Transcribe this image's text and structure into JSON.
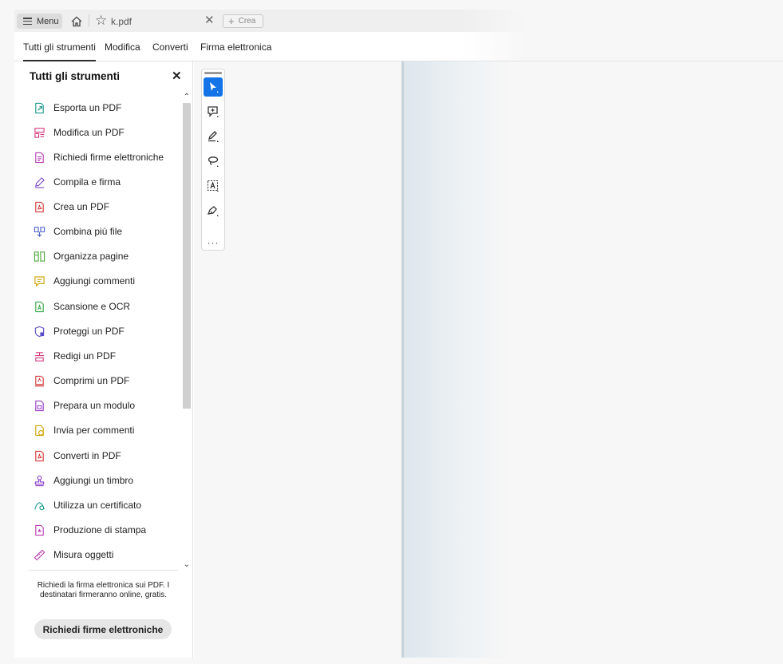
{
  "titlebar": {
    "menu_label": "Menu",
    "tab_title": "k.pdf",
    "new_tab_label": "Crea"
  },
  "topnav": {
    "items": [
      "Tutti gli strumenti",
      "Modifica",
      "Converti",
      "Firma elettronica"
    ]
  },
  "panel": {
    "title": "Tutti gli strumenti",
    "tools": [
      {
        "label": "Esporta un PDF",
        "icon": "export-pdf-icon",
        "color": "#1a9a8a"
      },
      {
        "label": "Modifica un PDF",
        "icon": "edit-pdf-icon",
        "color": "#d63b80"
      },
      {
        "label": "Richiedi firme elettroniche",
        "icon": "request-signatures-icon",
        "color": "#b83fb0"
      },
      {
        "label": "Compila e firma",
        "icon": "fill-sign-icon",
        "color": "#7d4cc7"
      },
      {
        "label": "Crea un PDF",
        "icon": "create-pdf-icon",
        "color": "#d63a3a"
      },
      {
        "label": "Combina più file",
        "icon": "combine-files-icon",
        "color": "#4f63c9"
      },
      {
        "label": "Organizza pagine",
        "icon": "organize-pages-icon",
        "color": "#4da83a"
      },
      {
        "label": "Aggiungi commenti",
        "icon": "add-comments-icon",
        "color": "#d2a200"
      },
      {
        "label": "Scansione e OCR",
        "icon": "scan-ocr-icon",
        "color": "#3aa84a"
      },
      {
        "label": "Proteggi un PDF",
        "icon": "protect-pdf-icon",
        "color": "#5b4fc9"
      },
      {
        "label": "Redigi un PDF",
        "icon": "redact-pdf-icon",
        "color": "#d63b80"
      },
      {
        "label": "Comprimi un PDF",
        "icon": "compress-pdf-icon",
        "color": "#d63a3a"
      },
      {
        "label": "Prepara un modulo",
        "icon": "prepare-form-icon",
        "color": "#9b3fc7"
      },
      {
        "label": "Invia per commenti",
        "icon": "send-for-comments-icon",
        "color": "#d2a200"
      },
      {
        "label": "Converti in PDF",
        "icon": "convert-to-pdf-icon",
        "color": "#d63a3a"
      },
      {
        "label": "Aggiungi un timbro",
        "icon": "stamp-icon",
        "color": "#8a3fc7"
      },
      {
        "label": "Utilizza un certificato",
        "icon": "certificate-icon",
        "color": "#1a9a8a"
      },
      {
        "label": "Produzione di stampa",
        "icon": "print-production-icon",
        "color": "#b83fb0"
      },
      {
        "label": "Misura oggetti",
        "icon": "measure-icon",
        "color": "#b83fb0"
      }
    ],
    "promo_text": "Richiedi la firma elettronica sui PDF. I destinatari firmeranno online, gratis.",
    "promo_button": "Richiedi firme elettroniche"
  },
  "vtoolbar": {
    "tools": [
      "select-icon",
      "comment-icon",
      "highlight-pen-icon",
      "lasso-icon",
      "text-select-icon",
      "draw-pen-icon"
    ],
    "more_label": "···",
    "accent": "#1473e6"
  }
}
